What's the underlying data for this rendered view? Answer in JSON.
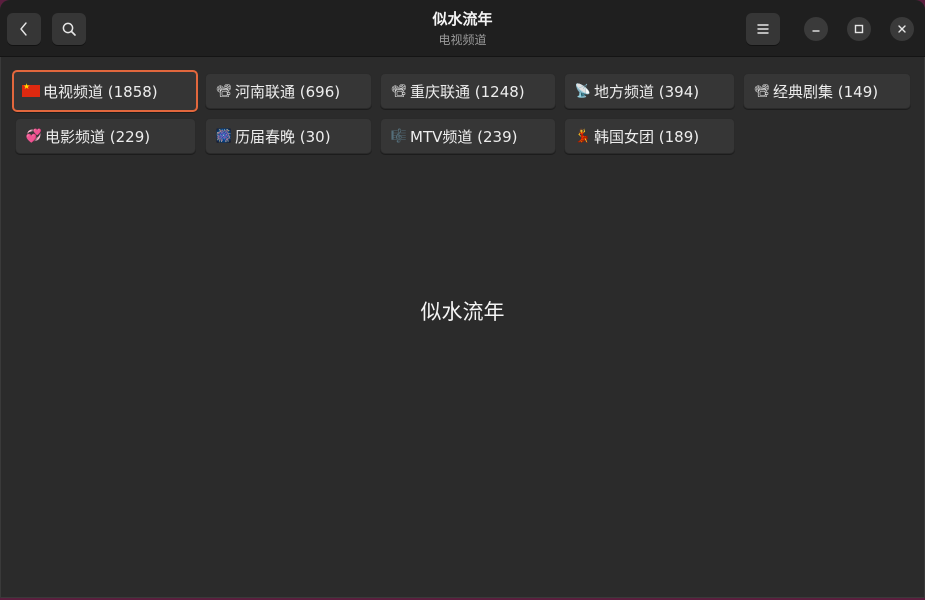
{
  "window": {
    "title": "似水流年",
    "subtitle": "电视频道"
  },
  "header": {
    "back_icon": "chevron-left-icon",
    "search_icon": "search-icon",
    "menu_icon": "hamburger-menu-icon",
    "minimize_icon": "minimize-icon",
    "maximize_icon": "maximize-icon",
    "close_icon": "close-icon"
  },
  "categories": [
    {
      "emoji": "🇨🇳",
      "label": "电视频道 (1858)",
      "selected": true
    },
    {
      "emoji": "📽",
      "label": "河南联通 (696)"
    },
    {
      "emoji": "📽",
      "label": "重庆联通 (1248)"
    },
    {
      "emoji": "📡",
      "label": "地方频道 (394)"
    },
    {
      "emoji": "📽",
      "label": "经典剧集 (149)"
    },
    {
      "emoji": "💞",
      "label": "电影频道 (229)"
    },
    {
      "emoji": "🎆",
      "label": "历届春晚 (30)"
    },
    {
      "emoji": "🎼",
      "label": "MTV频道 (239)"
    },
    {
      "emoji": "💃",
      "label": "韩国女团 (189)"
    }
  ],
  "content": {
    "placeholder_text": "似水流年"
  },
  "colors": {
    "accent": "#e2673d",
    "window_bg": "#2b2b2b",
    "headerbar_bg": "#1f1f1f",
    "button_bg": "#363636"
  }
}
